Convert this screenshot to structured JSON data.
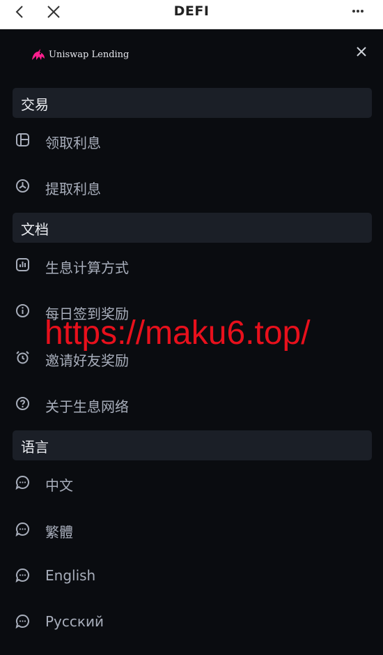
{
  "topbar": {
    "title": "DEFI"
  },
  "brand": {
    "name": "Uniswap Lending"
  },
  "sections": [
    {
      "title": "交易",
      "items": [
        {
          "label": "领取利息",
          "icon": "layout-icon"
        },
        {
          "label": "提取利息",
          "icon": "pie-chart-icon"
        }
      ]
    },
    {
      "title": "文档",
      "items": [
        {
          "label": "生息计算方式",
          "icon": "bar-chart-icon"
        },
        {
          "label": "每日签到奖励",
          "icon": "info-icon"
        },
        {
          "label": "邀请好友奖励",
          "icon": "alarm-icon"
        },
        {
          "label": "关于生息网络",
          "icon": "help-icon"
        }
      ]
    },
    {
      "title": "语言",
      "items": [
        {
          "label": "中文",
          "icon": "chat-icon"
        },
        {
          "label": "繁體",
          "icon": "chat-icon"
        },
        {
          "label": "English",
          "icon": "chat-icon"
        },
        {
          "label": "Русский",
          "icon": "chat-icon"
        }
      ]
    }
  ],
  "watermark": "https://maku6.top/",
  "colors": {
    "accent": "#e8101c",
    "text": "#a8aebb",
    "section_bg": "#1b1f27",
    "logo": "#ff1f8e"
  }
}
